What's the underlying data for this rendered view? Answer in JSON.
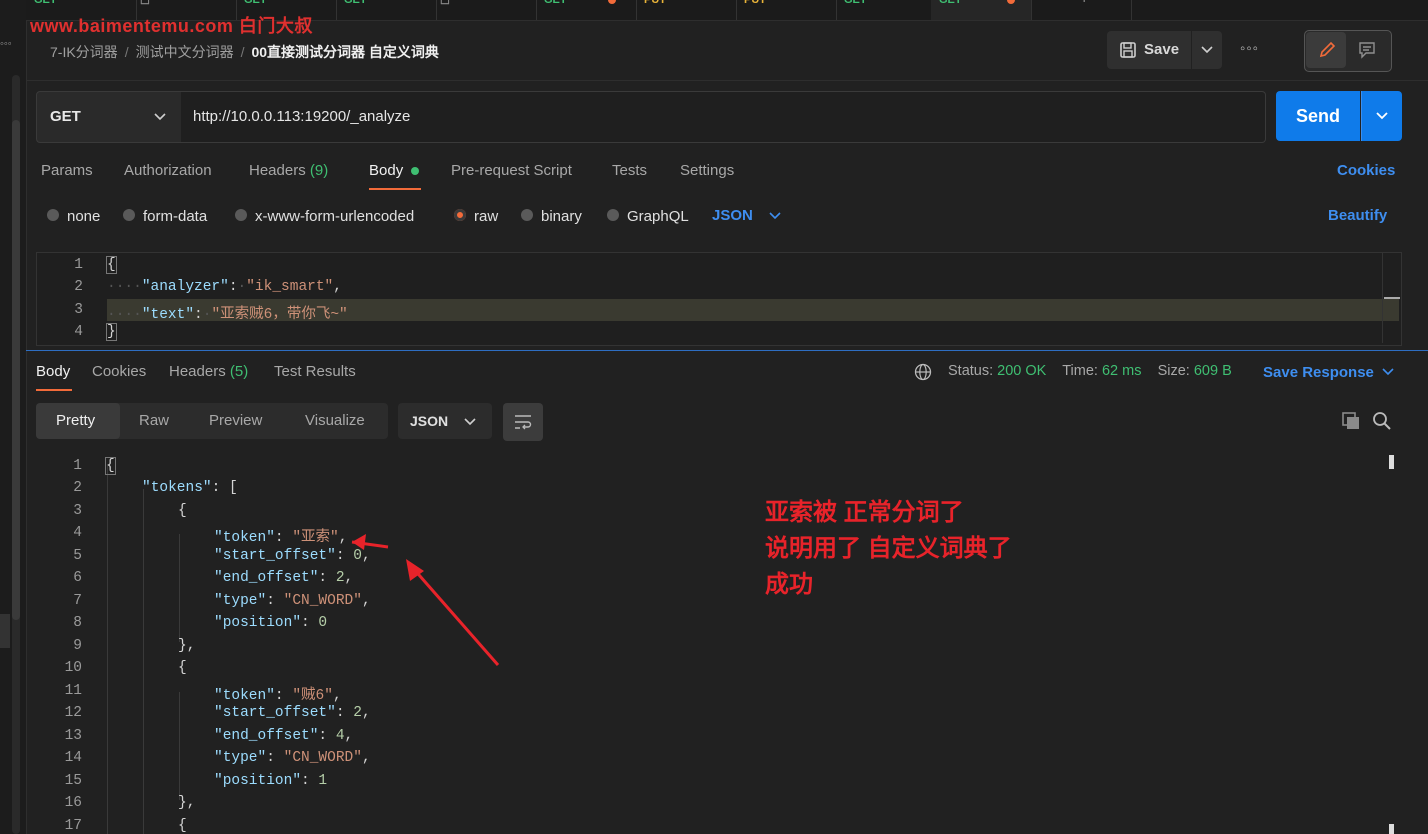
{
  "watermark": "www.baimentemu.com 白门大叔",
  "breadcrumb": {
    "items": [
      "7-IK分词器",
      "测试中文分词器"
    ],
    "current": "00直接测试分词器 自定义词典"
  },
  "toolbar": {
    "save_label": "Save"
  },
  "request": {
    "method": "GET",
    "url": "http://10.0.0.113:19200/_analyze",
    "send_label": "Send"
  },
  "request_tabs": {
    "params": "Params",
    "authorization": "Authorization",
    "headers": "Headers",
    "headers_count": "(9)",
    "body": "Body",
    "pre_request": "Pre-request Script",
    "tests": "Tests",
    "settings": "Settings",
    "cookies": "Cookies"
  },
  "body_types": {
    "none": "none",
    "form_data": "form-data",
    "urlencoded": "x-www-form-urlencoded",
    "raw": "raw",
    "binary": "binary",
    "graphql": "GraphQL",
    "format": "JSON",
    "beautify": "Beautify",
    "selected": "raw"
  },
  "request_body": {
    "line_numbers": [
      "1",
      "2",
      "3",
      "4"
    ],
    "key_analyzer": "\"analyzer\"",
    "val_analyzer": "\"ik_smart\"",
    "key_text": "\"text\"",
    "val_text": "\"亚索贼6，带你飞~\""
  },
  "response_tabs": {
    "body": "Body",
    "cookies": "Cookies",
    "headers": "Headers",
    "headers_count": "(5)",
    "test_results": "Test Results"
  },
  "response_status": {
    "status_label": "Status:",
    "status_value": "200 OK",
    "time_label": "Time:",
    "time_value": "62 ms",
    "size_label": "Size:",
    "size_value": "609 B",
    "save_response": "Save Response"
  },
  "view_tabs": {
    "pretty": "Pretty",
    "raw": "Raw",
    "preview": "Preview",
    "visualize": "Visualize",
    "format": "JSON"
  },
  "response_body": {
    "line_numbers": [
      "1",
      "2",
      "3",
      "4",
      "5",
      "6",
      "7",
      "8",
      "9",
      "10",
      "11",
      "12",
      "13",
      "14",
      "15",
      "16",
      "17"
    ],
    "tokens_key": "\"tokens\"",
    "token1": {
      "token": "\"亚索\"",
      "start_offset": "0",
      "end_offset": "2",
      "type": "\"CN_WORD\"",
      "position": "0"
    },
    "token2": {
      "token": "\"贼6\"",
      "start_offset": "2",
      "end_offset": "4",
      "type": "\"CN_WORD\"",
      "position": "1"
    },
    "k_token": "\"token\"",
    "k_start": "\"start_offset\"",
    "k_end": "\"end_offset\"",
    "k_type": "\"type\"",
    "k_position": "\"position\""
  },
  "annotation": {
    "line1": "亚索被 正常分词了",
    "line2": "说明用了 自定义词典了",
    "line3": "成功"
  },
  "colors": {
    "accent": "#f26b3a",
    "link": "#3e8ef0",
    "send": "#0f7bea",
    "ok": "#3fbf72",
    "annotation": "#e8232a"
  }
}
